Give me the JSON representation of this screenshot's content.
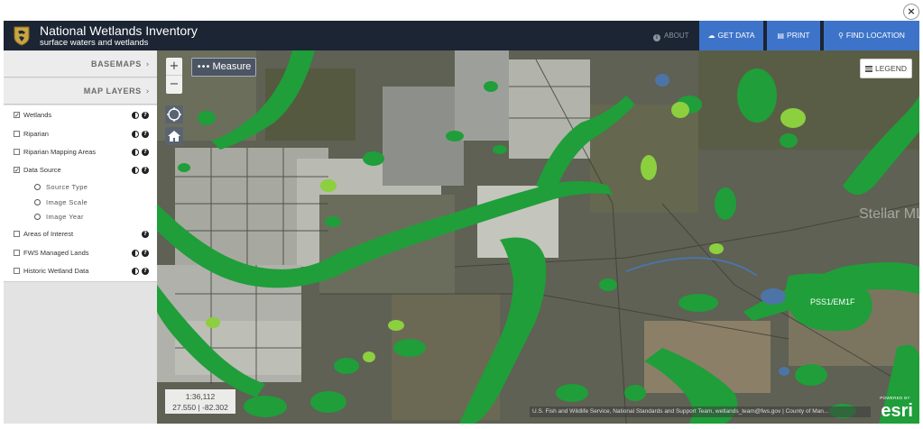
{
  "close": {
    "label": "×"
  },
  "header": {
    "title": "National Wetlands Inventory",
    "subtitle": "surface waters and wetlands",
    "about": "ABOUT",
    "buttons": {
      "get_data": "GET DATA",
      "print": "PRINT",
      "find_location": "FIND LOCATION"
    },
    "bg_color": "#1c2533",
    "button_color": "#3d74c9"
  },
  "sidebar": {
    "basemaps": "BASEMAPS",
    "map_layers": "MAP LAYERS",
    "layers": [
      {
        "label": "Wetlands",
        "checked": "✓"
      },
      {
        "label": "Riparian",
        "checked": ""
      },
      {
        "label": "Riparian Mapping Areas",
        "checked": ""
      },
      {
        "label": "Data Source",
        "checked": "✓"
      },
      {
        "label": "Areas of Interest",
        "checked": ""
      },
      {
        "label": "FWS Managed Lands",
        "checked": ""
      },
      {
        "label": "Historic Wetland Data",
        "checked": ""
      }
    ],
    "sublayers": [
      "Source Type",
      "Image Scale",
      "Image Year"
    ]
  },
  "map": {
    "zoom_in": "+",
    "zoom_out": "−",
    "measure": "Measure",
    "legend": "LEGEND",
    "scale": "1:36,112",
    "coordinates": "27.550 | -82.302",
    "watermark": "Stellar MLS",
    "wetland_label": "PSS1/EM1F",
    "attribution": "U.S. Fish and Wildlife Service, National Standards and Support Team, wetlands_team@fws.gov | County of Man...",
    "esri_powered": "POWERED BY",
    "esri_name": "esri",
    "wetland_color": "#1f9e3a",
    "freshwater_emergent_color": "#8ccf3f"
  }
}
